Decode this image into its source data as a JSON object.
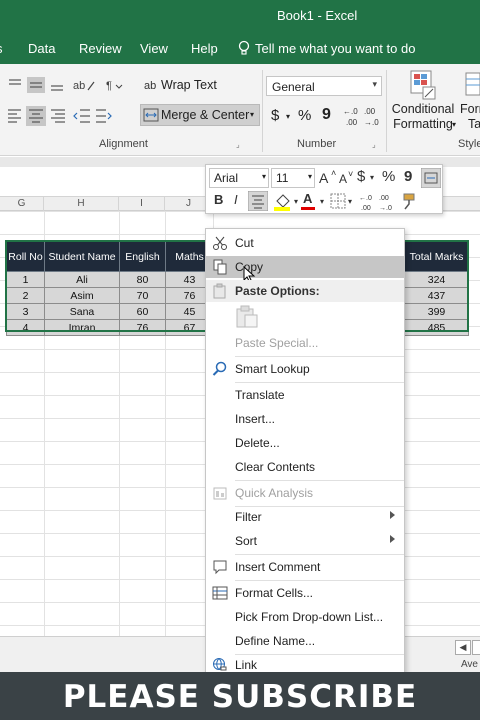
{
  "window": {
    "title": "Book1  -  Excel"
  },
  "menu": {
    "tabs": [
      "s",
      "Data",
      "Review",
      "View",
      "Help"
    ],
    "tell_me": "Tell me what you want to do"
  },
  "ribbon": {
    "wrap_text": "Wrap Text",
    "merge_center": "Merge & Center",
    "number_format": "General",
    "conditional_formatting_line1": "Conditional",
    "conditional_formatting_line2": "Formatting",
    "format_as_table_line1": "Form",
    "format_as_table_line2": "Ta",
    "group_alignment": "Alignment",
    "group_number": "Number",
    "group_styles": "Style",
    "currency_symbol": "$",
    "percent_symbol": "%",
    "comma_symbol": "9",
    "inc_decimal": ".00",
    "dec_decimal": ".0"
  },
  "grid": {
    "columns": [
      "G",
      "H",
      "I",
      "J"
    ],
    "headers": [
      "Roll No",
      "Student Name",
      "English",
      "Maths"
    ],
    "rows": [
      [
        "1",
        "Ali",
        "80",
        "43"
      ],
      [
        "2",
        "Asim",
        "70",
        "76"
      ],
      [
        "3",
        "Sana",
        "60",
        "45"
      ],
      [
        "4",
        "Imran",
        "76",
        "67"
      ]
    ],
    "total_header": "Total Marks",
    "totals": [
      "324",
      "437",
      "399",
      "485"
    ]
  },
  "mini_toolbar": {
    "font": "Arial",
    "size": "11",
    "bold": "B",
    "italic": "I",
    "font_color_letter": "A",
    "grow_font": "A",
    "shrink_font": "A",
    "currency": "$",
    "percent": "%",
    "comma": "9"
  },
  "context_menu": {
    "cut": "Cut",
    "copy": "Copy",
    "paste_options": "Paste Options:",
    "paste_special": "Paste Special...",
    "smart_lookup": "Smart Lookup",
    "translate": "Translate",
    "insert": "Insert...",
    "delete": "Delete...",
    "clear_contents": "Clear Contents",
    "quick_analysis": "Quick Analysis",
    "filter": "Filter",
    "sort": "Sort",
    "insert_comment": "Insert Comment",
    "format_cells": "Format Cells...",
    "pick_list": "Pick From Drop-down List...",
    "define_name": "Define Name...",
    "link": "Link"
  },
  "status": {
    "average": "Ave"
  },
  "banner": {
    "text": "PLEASE SUBSCRIBE"
  },
  "colors": {
    "excel_green": "#217346",
    "header_dark": "#1f2a3a",
    "row_gray": "#d7d7d7",
    "highlight": "#c6c6c6",
    "banner": "#3a4246"
  },
  "icons": [
    "lightbulb-icon",
    "cut-icon",
    "copy-icon",
    "paste-icon",
    "search-icon",
    "comment-icon",
    "format-cells-icon",
    "link-icon",
    "quick-analysis-icon",
    "mouse-cursor-icon"
  ]
}
